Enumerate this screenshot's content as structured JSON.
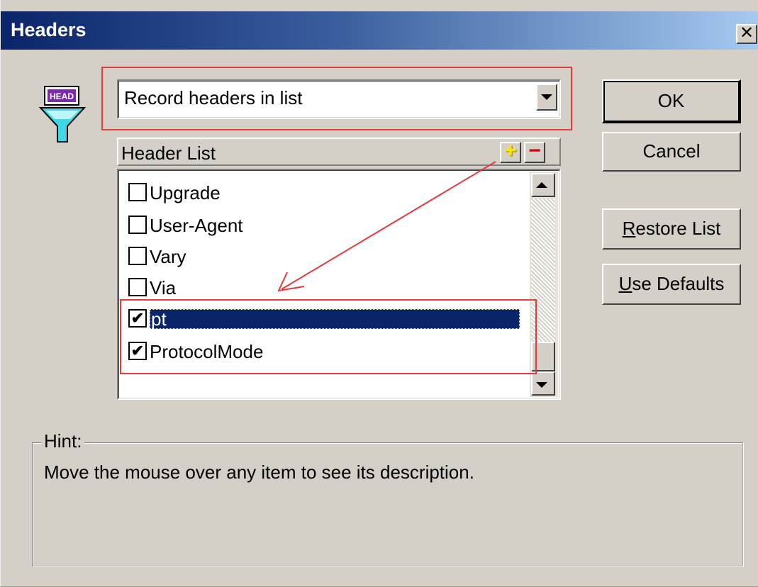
{
  "window": {
    "title": "Headers",
    "close_glyph": "✕"
  },
  "icon": {
    "name": "head-filter-icon",
    "badge_text": "HEAD"
  },
  "mode_dropdown": {
    "selected": "Record headers in list"
  },
  "header_list": {
    "label": "Header List",
    "add_glyph": "+",
    "remove_glyph": "−",
    "items": [
      {
        "label": "Upgrade",
        "checked": false,
        "mark": ""
      },
      {
        "label": "User-Agent",
        "checked": false,
        "mark": ""
      },
      {
        "label": "Vary",
        "checked": false,
        "mark": ""
      },
      {
        "label": "Via",
        "checked": false,
        "mark": ""
      },
      {
        "label": "pt",
        "checked": true,
        "selected": true,
        "mark": "✔"
      },
      {
        "label": "ProtocolMode",
        "checked": true,
        "mark": "✔"
      }
    ]
  },
  "buttons": {
    "ok": "OK",
    "cancel": "Cancel",
    "restore_first": "R",
    "restore_rest": "estore List",
    "defaults_first": "U",
    "defaults_rest": "se Defaults"
  },
  "hint": {
    "legend": "Hint:",
    "text": "Move the mouse over any item to see its description."
  },
  "colors": {
    "annotation_red": "#e8393c",
    "selection_blue": "#0a246a",
    "dialog_face": "#d4d0c8",
    "add_yellow": "#ffe800",
    "remove_red": "#e00000"
  }
}
